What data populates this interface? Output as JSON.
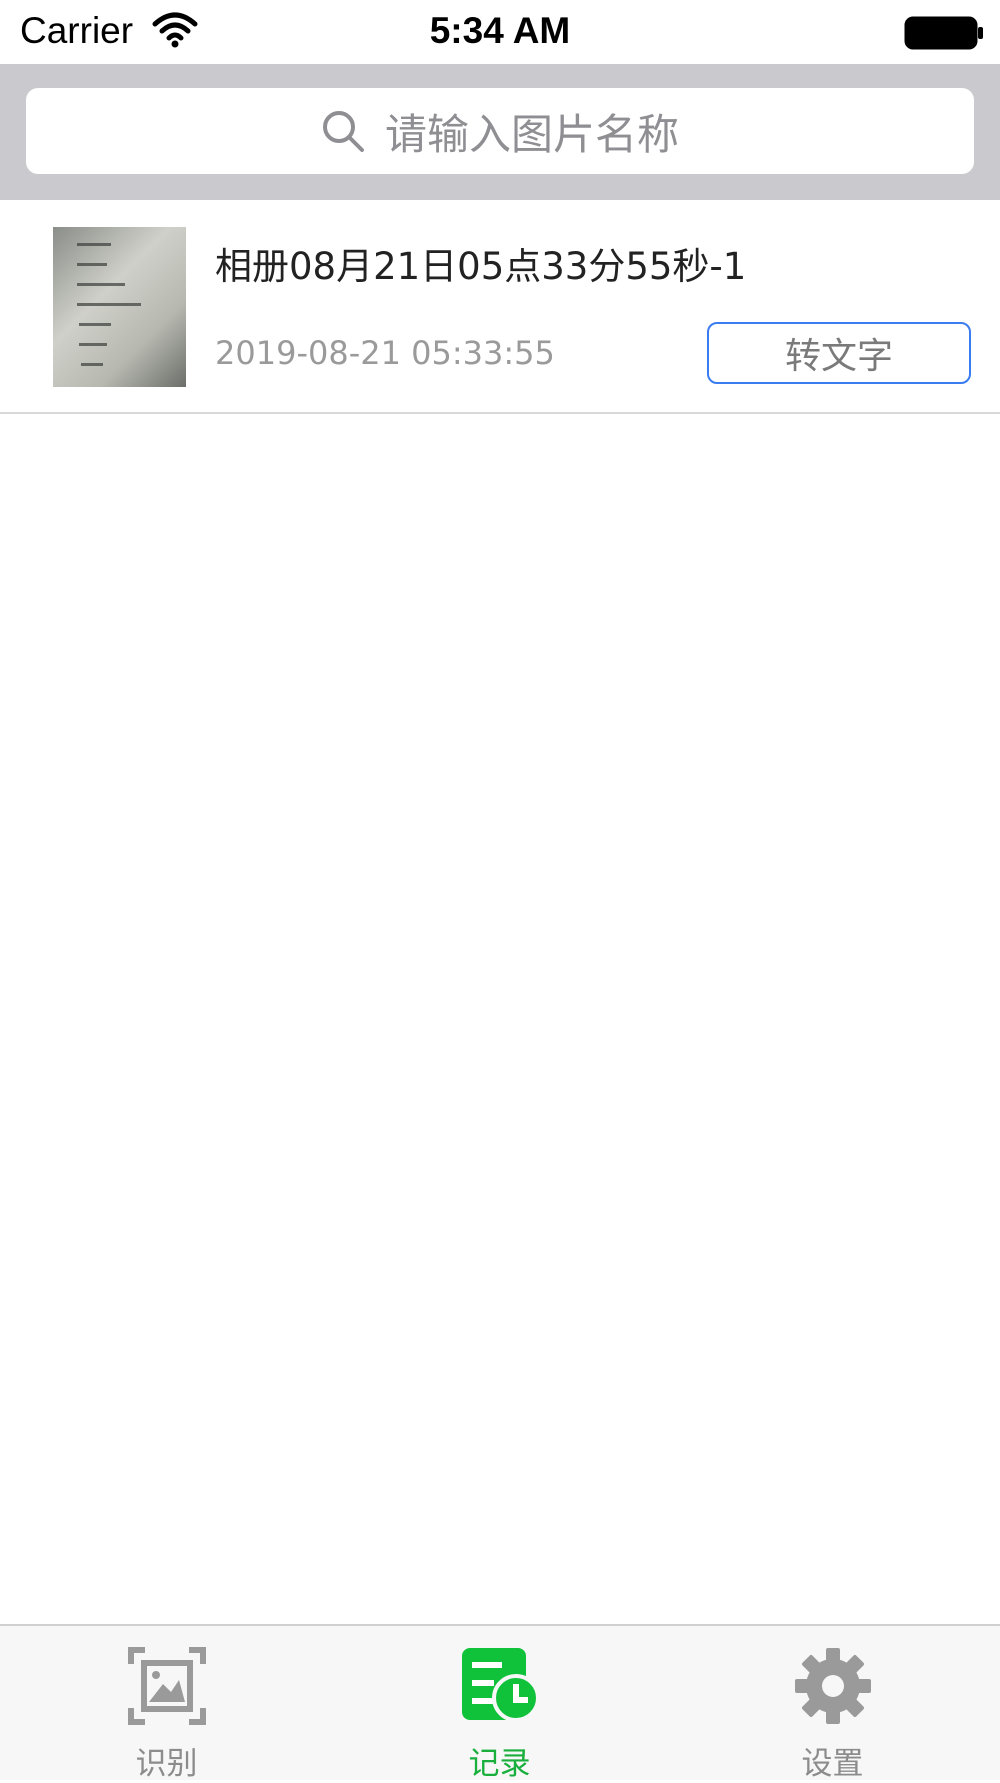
{
  "status_bar": {
    "carrier": "Carrier",
    "time": "5:34 AM"
  },
  "search": {
    "placeholder": "请输入图片名称"
  },
  "records": [
    {
      "title": "相册08月21日05点33分55秒-1",
      "date": "2019-08-21 05:33:55",
      "action_label": "转文字"
    }
  ],
  "tabs": [
    {
      "label": "识别",
      "icon": "image-scan-icon",
      "active": false
    },
    {
      "label": "记录",
      "icon": "record-history-icon",
      "active": true
    },
    {
      "label": "设置",
      "icon": "gear-icon",
      "active": false
    }
  ],
  "colors": {
    "accent": "#1aaf3c",
    "button_border": "#3b7df0",
    "search_bg": "#c9c9ce"
  }
}
